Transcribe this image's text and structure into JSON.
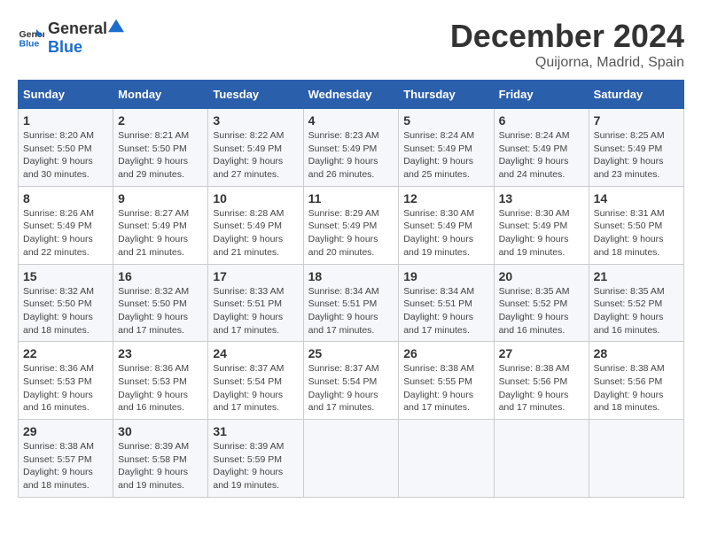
{
  "logo": {
    "text_general": "General",
    "text_blue": "Blue"
  },
  "header": {
    "month": "December 2024",
    "location": "Quijorna, Madrid, Spain"
  },
  "weekdays": [
    "Sunday",
    "Monday",
    "Tuesday",
    "Wednesday",
    "Thursday",
    "Friday",
    "Saturday"
  ],
  "weeks": [
    [
      {
        "day": "1",
        "sunrise": "Sunrise: 8:20 AM",
        "sunset": "Sunset: 5:50 PM",
        "daylight": "Daylight: 9 hours and 30 minutes."
      },
      {
        "day": "2",
        "sunrise": "Sunrise: 8:21 AM",
        "sunset": "Sunset: 5:50 PM",
        "daylight": "Daylight: 9 hours and 29 minutes."
      },
      {
        "day": "3",
        "sunrise": "Sunrise: 8:22 AM",
        "sunset": "Sunset: 5:49 PM",
        "daylight": "Daylight: 9 hours and 27 minutes."
      },
      {
        "day": "4",
        "sunrise": "Sunrise: 8:23 AM",
        "sunset": "Sunset: 5:49 PM",
        "daylight": "Daylight: 9 hours and 26 minutes."
      },
      {
        "day": "5",
        "sunrise": "Sunrise: 8:24 AM",
        "sunset": "Sunset: 5:49 PM",
        "daylight": "Daylight: 9 hours and 25 minutes."
      },
      {
        "day": "6",
        "sunrise": "Sunrise: 8:24 AM",
        "sunset": "Sunset: 5:49 PM",
        "daylight": "Daylight: 9 hours and 24 minutes."
      },
      {
        "day": "7",
        "sunrise": "Sunrise: 8:25 AM",
        "sunset": "Sunset: 5:49 PM",
        "daylight": "Daylight: 9 hours and 23 minutes."
      }
    ],
    [
      {
        "day": "8",
        "sunrise": "Sunrise: 8:26 AM",
        "sunset": "Sunset: 5:49 PM",
        "daylight": "Daylight: 9 hours and 22 minutes."
      },
      {
        "day": "9",
        "sunrise": "Sunrise: 8:27 AM",
        "sunset": "Sunset: 5:49 PM",
        "daylight": "Daylight: 9 hours and 21 minutes."
      },
      {
        "day": "10",
        "sunrise": "Sunrise: 8:28 AM",
        "sunset": "Sunset: 5:49 PM",
        "daylight": "Daylight: 9 hours and 21 minutes."
      },
      {
        "day": "11",
        "sunrise": "Sunrise: 8:29 AM",
        "sunset": "Sunset: 5:49 PM",
        "daylight": "Daylight: 9 hours and 20 minutes."
      },
      {
        "day": "12",
        "sunrise": "Sunrise: 8:30 AM",
        "sunset": "Sunset: 5:49 PM",
        "daylight": "Daylight: 9 hours and 19 minutes."
      },
      {
        "day": "13",
        "sunrise": "Sunrise: 8:30 AM",
        "sunset": "Sunset: 5:49 PM",
        "daylight": "Daylight: 9 hours and 19 minutes."
      },
      {
        "day": "14",
        "sunrise": "Sunrise: 8:31 AM",
        "sunset": "Sunset: 5:50 PM",
        "daylight": "Daylight: 9 hours and 18 minutes."
      }
    ],
    [
      {
        "day": "15",
        "sunrise": "Sunrise: 8:32 AM",
        "sunset": "Sunset: 5:50 PM",
        "daylight": "Daylight: 9 hours and 18 minutes."
      },
      {
        "day": "16",
        "sunrise": "Sunrise: 8:32 AM",
        "sunset": "Sunset: 5:50 PM",
        "daylight": "Daylight: 9 hours and 17 minutes."
      },
      {
        "day": "17",
        "sunrise": "Sunrise: 8:33 AM",
        "sunset": "Sunset: 5:51 PM",
        "daylight": "Daylight: 9 hours and 17 minutes."
      },
      {
        "day": "18",
        "sunrise": "Sunrise: 8:34 AM",
        "sunset": "Sunset: 5:51 PM",
        "daylight": "Daylight: 9 hours and 17 minutes."
      },
      {
        "day": "19",
        "sunrise": "Sunrise: 8:34 AM",
        "sunset": "Sunset: 5:51 PM",
        "daylight": "Daylight: 9 hours and 17 minutes."
      },
      {
        "day": "20",
        "sunrise": "Sunrise: 8:35 AM",
        "sunset": "Sunset: 5:52 PM",
        "daylight": "Daylight: 9 hours and 16 minutes."
      },
      {
        "day": "21",
        "sunrise": "Sunrise: 8:35 AM",
        "sunset": "Sunset: 5:52 PM",
        "daylight": "Daylight: 9 hours and 16 minutes."
      }
    ],
    [
      {
        "day": "22",
        "sunrise": "Sunrise: 8:36 AM",
        "sunset": "Sunset: 5:53 PM",
        "daylight": "Daylight: 9 hours and 16 minutes."
      },
      {
        "day": "23",
        "sunrise": "Sunrise: 8:36 AM",
        "sunset": "Sunset: 5:53 PM",
        "daylight": "Daylight: 9 hours and 16 minutes."
      },
      {
        "day": "24",
        "sunrise": "Sunrise: 8:37 AM",
        "sunset": "Sunset: 5:54 PM",
        "daylight": "Daylight: 9 hours and 17 minutes."
      },
      {
        "day": "25",
        "sunrise": "Sunrise: 8:37 AM",
        "sunset": "Sunset: 5:54 PM",
        "daylight": "Daylight: 9 hours and 17 minutes."
      },
      {
        "day": "26",
        "sunrise": "Sunrise: 8:38 AM",
        "sunset": "Sunset: 5:55 PM",
        "daylight": "Daylight: 9 hours and 17 minutes."
      },
      {
        "day": "27",
        "sunrise": "Sunrise: 8:38 AM",
        "sunset": "Sunset: 5:56 PM",
        "daylight": "Daylight: 9 hours and 17 minutes."
      },
      {
        "day": "28",
        "sunrise": "Sunrise: 8:38 AM",
        "sunset": "Sunset: 5:56 PM",
        "daylight": "Daylight: 9 hours and 18 minutes."
      }
    ],
    [
      {
        "day": "29",
        "sunrise": "Sunrise: 8:38 AM",
        "sunset": "Sunset: 5:57 PM",
        "daylight": "Daylight: 9 hours and 18 minutes."
      },
      {
        "day": "30",
        "sunrise": "Sunrise: 8:39 AM",
        "sunset": "Sunset: 5:58 PM",
        "daylight": "Daylight: 9 hours and 19 minutes."
      },
      {
        "day": "31",
        "sunrise": "Sunrise: 8:39 AM",
        "sunset": "Sunset: 5:59 PM",
        "daylight": "Daylight: 9 hours and 19 minutes."
      },
      null,
      null,
      null,
      null
    ]
  ]
}
